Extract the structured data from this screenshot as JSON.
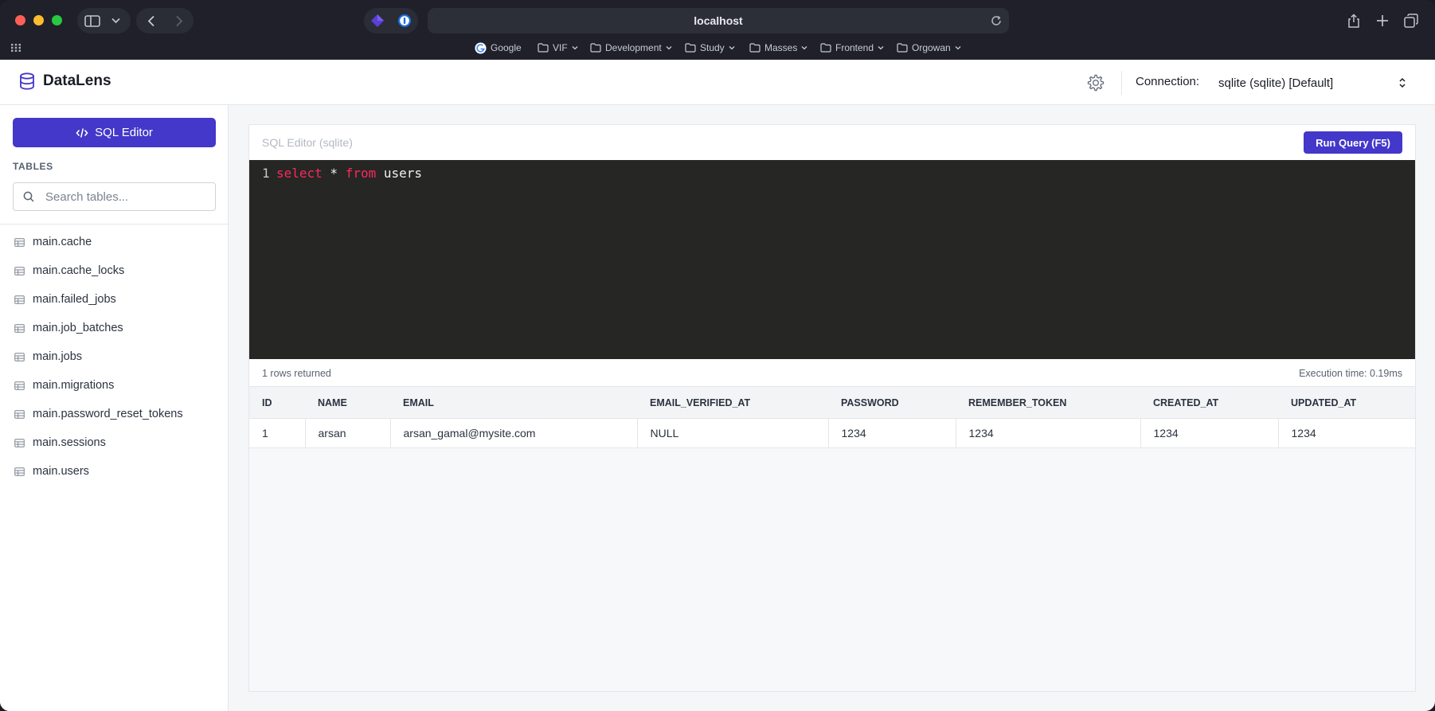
{
  "browser": {
    "url": "localhost",
    "bookmarks": [
      "Google",
      "VIF",
      "Development",
      "Study",
      "Masses",
      "Frontend",
      "Orgowan"
    ]
  },
  "app": {
    "title": "DataLens",
    "connection_label": "Connection:",
    "connection_value": "sqlite (sqlite) [Default]",
    "accent_color": "#4338ca"
  },
  "sidebar": {
    "sql_editor_label": "SQL Editor",
    "tables_heading": "TABLES",
    "search_placeholder": "Search tables...",
    "tables": [
      "main.cache",
      "main.cache_locks",
      "main.failed_jobs",
      "main.job_batches",
      "main.jobs",
      "main.migrations",
      "main.password_reset_tokens",
      "main.sessions",
      "main.users"
    ]
  },
  "editor": {
    "title": "SQL Editor (sqlite)",
    "run_label": "Run Query (F5)",
    "line_number": "1",
    "query_kw1": "select",
    "query_mid": " * ",
    "query_kw2": "from",
    "query_end": " users"
  },
  "results": {
    "rows_returned": "1 rows returned",
    "execution_time": "Execution time: 0.19ms",
    "columns": [
      "ID",
      "NAME",
      "EMAIL",
      "EMAIL_VERIFIED_AT",
      "PASSWORD",
      "REMEMBER_TOKEN",
      "CREATED_AT",
      "UPDATED_AT"
    ],
    "rows": [
      [
        "1",
        "arsan",
        "arsan_gamal@mysite.com",
        "NULL",
        "1234",
        "1234",
        "1234",
        "1234"
      ]
    ]
  }
}
